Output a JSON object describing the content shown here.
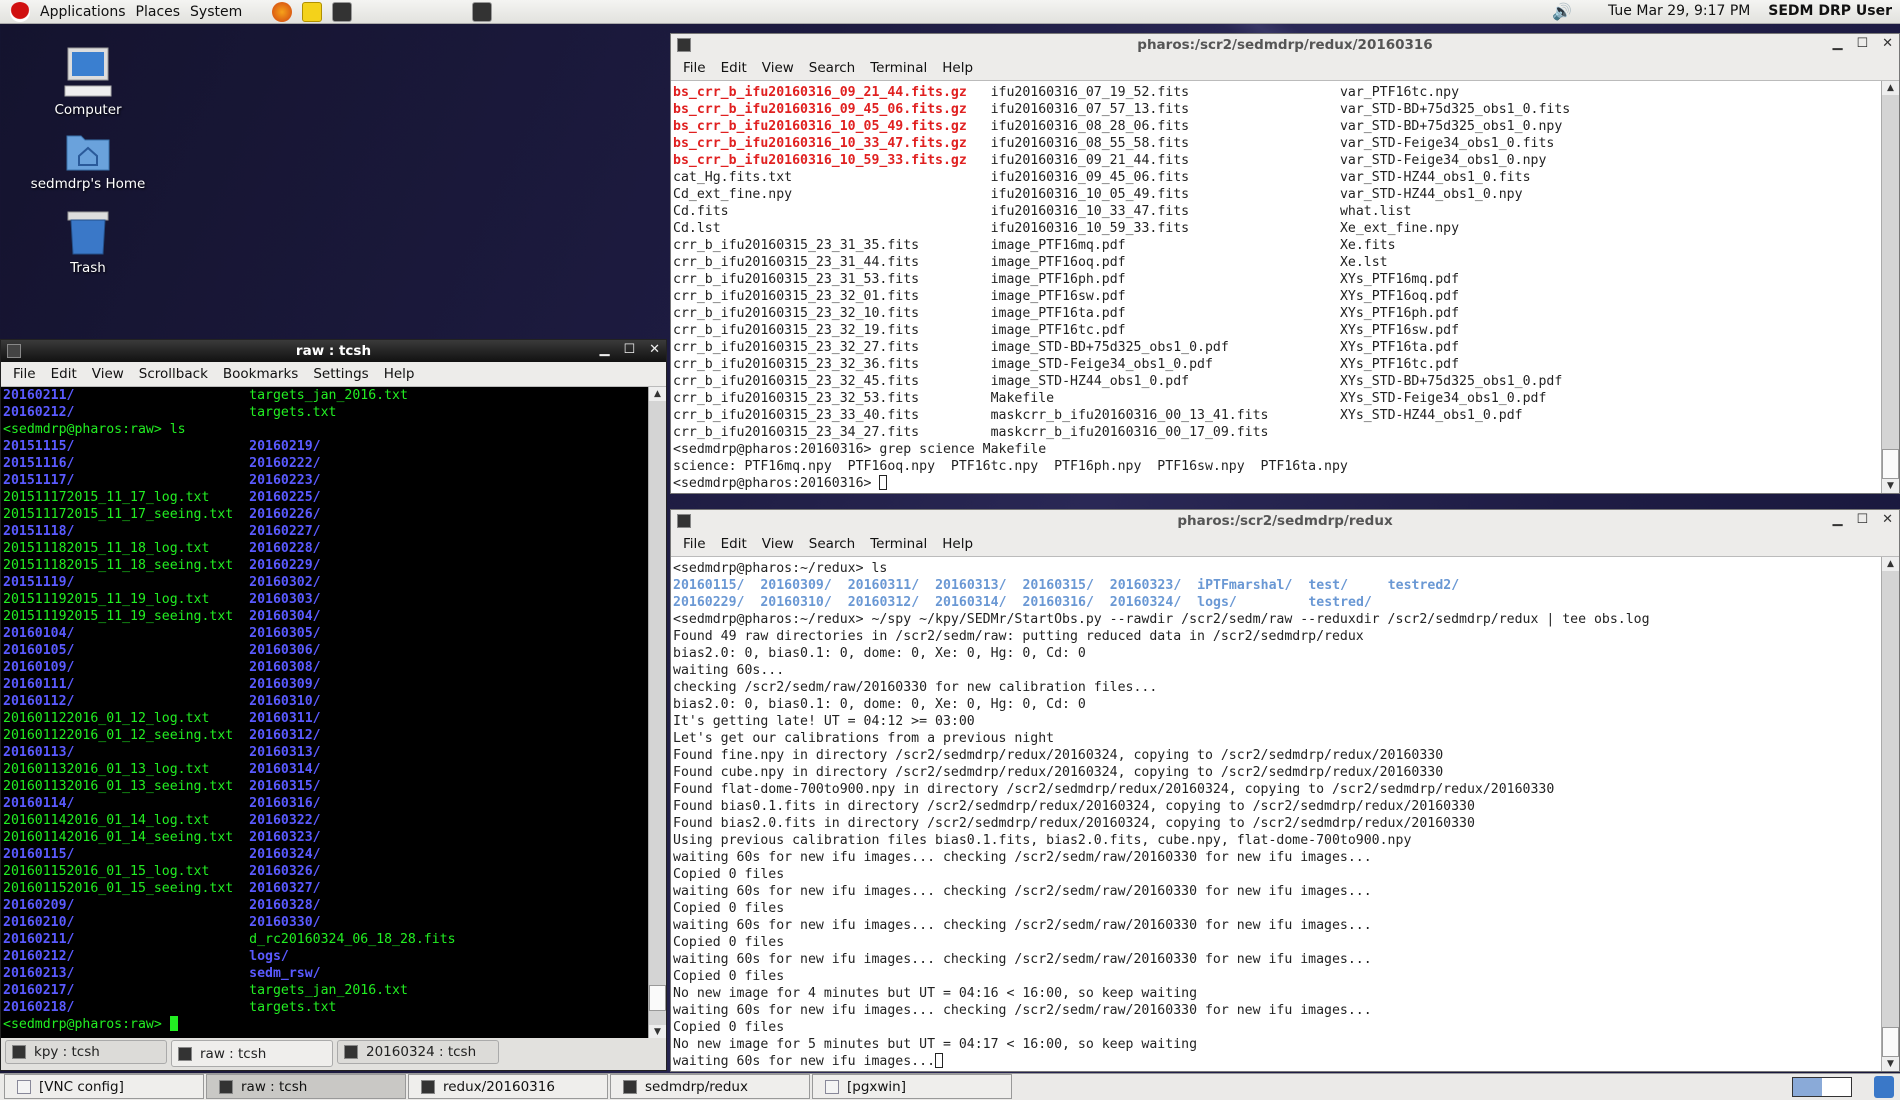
{
  "top_panel": {
    "menus": [
      "Applications",
      "Places",
      "System"
    ],
    "launchers": [
      "firefox-icon",
      "notes-icon",
      "terminal-icon"
    ],
    "clock": "Tue Mar 29,  9:17 PM",
    "user": "SEDM DRP User"
  },
  "desktop": {
    "icons": [
      {
        "label": "Computer",
        "icon": "computer-icon"
      },
      {
        "label": "sedmdrp's Home",
        "icon": "home-folder-icon"
      },
      {
        "label": "Trash",
        "icon": "trash-icon"
      }
    ]
  },
  "colors": {
    "archive_red": "#e02020",
    "dir_blue": "#5a5aff",
    "file_green": "#22ee22",
    "redux_dir": "#6a98d4"
  },
  "win_top": {
    "title": "pharos:/scr2/sedmdrp/redux/20160316",
    "menu": [
      "File",
      "Edit",
      "View",
      "Search",
      "Terminal",
      "Help"
    ],
    "grid": [
      [
        {
          "text": "bs_crr_b_ifu20160316_09_21_44.fits.gz",
          "red": true
        },
        "ifu20160316_07_19_52.fits",
        "var_PTF16tc.npy"
      ],
      [
        {
          "text": "bs_crr_b_ifu20160316_09_45_06.fits.gz",
          "red": true
        },
        "ifu20160316_07_57_13.fits",
        "var_STD-BD+75d325_obs1_0.fits"
      ],
      [
        {
          "text": "bs_crr_b_ifu20160316_10_05_49.fits.gz",
          "red": true
        },
        "ifu20160316_08_28_06.fits",
        "var_STD-BD+75d325_obs1_0.npy"
      ],
      [
        {
          "text": "bs_crr_b_ifu20160316_10_33_47.fits.gz",
          "red": true
        },
        "ifu20160316_08_55_58.fits",
        "var_STD-Feige34_obs1_0.fits"
      ],
      [
        {
          "text": "bs_crr_b_ifu20160316_10_59_33.fits.gz",
          "red": true
        },
        "ifu20160316_09_21_44.fits",
        "var_STD-Feige34_obs1_0.npy"
      ],
      [
        "cat_Hg.fits.txt",
        "ifu20160316_09_45_06.fits",
        "var_STD-HZ44_obs1_0.fits"
      ],
      [
        "Cd_ext_fine.npy",
        "ifu20160316_10_05_49.fits",
        "var_STD-HZ44_obs1_0.npy"
      ],
      [
        "Cd.fits",
        "ifu20160316_10_33_47.fits",
        "what.list"
      ],
      [
        "Cd.lst",
        "ifu20160316_10_59_33.fits",
        "Xe_ext_fine.npy"
      ],
      [
        "crr_b_ifu20160315_23_31_35.fits",
        "image_PTF16mq.pdf",
        "Xe.fits"
      ],
      [
        "crr_b_ifu20160315_23_31_44.fits",
        "image_PTF16oq.pdf",
        "Xe.lst"
      ],
      [
        "crr_b_ifu20160315_23_31_53.fits",
        "image_PTF16ph.pdf",
        "XYs_PTF16mq.pdf"
      ],
      [
        "crr_b_ifu20160315_23_32_01.fits",
        "image_PTF16sw.pdf",
        "XYs_PTF16oq.pdf"
      ],
      [
        "crr_b_ifu20160315_23_32_10.fits",
        "image_PTF16ta.pdf",
        "XYs_PTF16ph.pdf"
      ],
      [
        "crr_b_ifu20160315_23_32_19.fits",
        "image_PTF16tc.pdf",
        "XYs_PTF16sw.pdf"
      ],
      [
        "crr_b_ifu20160315_23_32_27.fits",
        "image_STD-BD+75d325_obs1_0.pdf",
        "XYs_PTF16ta.pdf"
      ],
      [
        "crr_b_ifu20160315_23_32_36.fits",
        "image_STD-Feige34_obs1_0.pdf",
        "XYs_PTF16tc.pdf"
      ],
      [
        "crr_b_ifu20160315_23_32_45.fits",
        "image_STD-HZ44_obs1_0.pdf",
        "XYs_STD-BD+75d325_obs1_0.pdf"
      ],
      [
        "crr_b_ifu20160315_23_32_53.fits",
        "Makefile",
        "XYs_STD-Feige34_obs1_0.pdf"
      ],
      [
        "crr_b_ifu20160315_23_33_40.fits",
        "maskcrr_b_ifu20160316_00_13_41.fits",
        "XYs_STD-HZ44_obs1_0.pdf"
      ],
      [
        "crr_b_ifu20160315_23_34_27.fits",
        "maskcrr_b_ifu20160316_00_17_09.fits",
        ""
      ]
    ],
    "after": [
      "<sedmdrp@pharos:20160316> grep science Makefile",
      "science: PTF16mq.npy  PTF16oq.npy  PTF16tc.npy  PTF16ph.npy  PTF16sw.npy  PTF16ta.npy"
    ],
    "prompt": "<sedmdrp@pharos:20160316> "
  },
  "win_raw": {
    "title": "raw : tcsh",
    "menu": [
      "File",
      "Edit",
      "View",
      "Scrollback",
      "Bookmarks",
      "Settings",
      "Help"
    ],
    "head": [
      [
        "20160211/",
        "targets_jan_2016.txt"
      ],
      [
        "20160212/",
        "targets.txt"
      ]
    ],
    "cmd": "<sedmdrp@pharos:raw> ls",
    "grid": [
      [
        "20151115/",
        "20160219/"
      ],
      [
        "20151116/",
        "20160222/"
      ],
      [
        "20151117/",
        "20160223/"
      ],
      [
        "201511172015_11_17_log.txt",
        "20160225/"
      ],
      [
        "201511172015_11_17_seeing.txt",
        "20160226/"
      ],
      [
        "20151118/",
        "20160227/"
      ],
      [
        "201511182015_11_18_log.txt",
        "20160228/"
      ],
      [
        "201511182015_11_18_seeing.txt",
        "20160229/"
      ],
      [
        "20151119/",
        "20160302/"
      ],
      [
        "201511192015_11_19_log.txt",
        "20160303/"
      ],
      [
        "201511192015_11_19_seeing.txt",
        "20160304/"
      ],
      [
        "20160104/",
        "20160305/"
      ],
      [
        "20160105/",
        "20160306/"
      ],
      [
        "20160109/",
        "20160308/"
      ],
      [
        "20160111/",
        "20160309/"
      ],
      [
        "20160112/",
        "20160310/"
      ],
      [
        "201601122016_01_12_log.txt",
        "20160311/"
      ],
      [
        "201601122016_01_12_seeing.txt",
        "20160312/"
      ],
      [
        "20160113/",
        "20160313/"
      ],
      [
        "201601132016_01_13_log.txt",
        "20160314/"
      ],
      [
        "201601132016_01_13_seeing.txt",
        "20160315/"
      ],
      [
        "20160114/",
        "20160316/"
      ],
      [
        "201601142016_01_14_log.txt",
        "20160322/"
      ],
      [
        "201601142016_01_14_seeing.txt",
        "20160323/"
      ],
      [
        "20160115/",
        "20160324/"
      ],
      [
        "201601152016_01_15_log.txt",
        "20160326/"
      ],
      [
        "201601152016_01_15_seeing.txt",
        "20160327/"
      ],
      [
        "20160209/",
        "20160328/"
      ],
      [
        "20160210/",
        "20160330/"
      ],
      [
        "20160211/",
        "d_rc20160324_06_18_28.fits"
      ],
      [
        "20160212/",
        "logs/"
      ],
      [
        "20160213/",
        "sedm_rsw/"
      ],
      [
        "20160217/",
        "targets_jan_2016.txt"
      ],
      [
        "20160218/",
        "targets.txt"
      ]
    ],
    "prompt": "<sedmdrp@pharos:raw> ",
    "tabs": [
      "kpy : tcsh",
      "raw : tcsh",
      "20160324 : tcsh"
    ],
    "active_tab": 1
  },
  "win_redux": {
    "title": "pharos:/scr2/sedmdrp/redux",
    "menu": [
      "File",
      "Edit",
      "View",
      "Search",
      "Terminal",
      "Help"
    ],
    "cmd": "<sedmdrp@pharos:~/redux> ls",
    "ls": [
      [
        "20160115/",
        "20160309/",
        "20160311/",
        "20160313/",
        "20160315/",
        "20160323/",
        "iPTFmarshal/",
        "test/",
        "testred2/"
      ],
      [
        "20160229/",
        "20160310/",
        "20160312/",
        "20160314/",
        "20160316/",
        "20160324/",
        "logs/",
        "testred/"
      ]
    ],
    "lines": [
      "<sedmdrp@pharos:~/redux> ~/spy ~/kpy/SEDMr/StartObs.py --rawdir /scr2/sedm/raw --reduxdir /scr2/sedmdrp/redux | tee obs.log",
      "Found 49 raw directories in /scr2/sedm/raw: putting reduced data in /scr2/sedmdrp/redux",
      "bias2.0: 0, bias0.1: 0, dome: 0, Xe: 0, Hg: 0, Cd: 0",
      "waiting 60s...",
      "checking /scr2/sedm/raw/20160330 for new calibration files...",
      "bias2.0: 0, bias0.1: 0, dome: 0, Xe: 0, Hg: 0, Cd: 0",
      "It's getting late! UT = 04:12 >= 03:00",
      "Let's get our calibrations from a previous night",
      "Found fine.npy in directory /scr2/sedmdrp/redux/20160324, copying to /scr2/sedmdrp/redux/20160330",
      "Found cube.npy in directory /scr2/sedmdrp/redux/20160324, copying to /scr2/sedmdrp/redux/20160330",
      "Found flat-dome-700to900.npy in directory /scr2/sedmdrp/redux/20160324, copying to /scr2/sedmdrp/redux/20160330",
      "Found bias0.1.fits in directory /scr2/sedmdrp/redux/20160324, copying to /scr2/sedmdrp/redux/20160330",
      "Found bias2.0.fits in directory /scr2/sedmdrp/redux/20160324, copying to /scr2/sedmdrp/redux/20160330",
      "Using previous calibration files bias0.1.fits, bias2.0.fits, cube.npy, flat-dome-700to900.npy",
      "waiting 60s for new ifu images... checking /scr2/sedm/raw/20160330 for new ifu images...",
      "Copied 0 files",
      "waiting 60s for new ifu images... checking /scr2/sedm/raw/20160330 for new ifu images...",
      "Copied 0 files",
      "waiting 60s for new ifu images... checking /scr2/sedm/raw/20160330 for new ifu images...",
      "Copied 0 files",
      "waiting 60s for new ifu images... checking /scr2/sedm/raw/20160330 for new ifu images...",
      "Copied 0 files",
      "No new image for 4 minutes but UT = 04:16 < 16:00, so keep waiting",
      "waiting 60s for new ifu images... checking /scr2/sedm/raw/20160330 for new ifu images...",
      "Copied 0 files",
      "No new image for 5 minutes but UT = 04:17 < 16:00, so keep waiting"
    ],
    "last": "waiting 60s for new ifu images..."
  },
  "taskbar": {
    "items": [
      "[VNC config]",
      "raw : tcsh",
      "redux/20160316",
      "sedmdrp/redux",
      "[pgxwin]"
    ],
    "active": 1
  }
}
